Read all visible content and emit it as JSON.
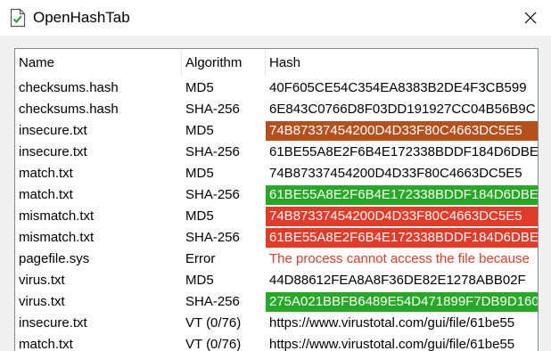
{
  "window": {
    "title": "OpenHashTab",
    "close_icon": "close-icon",
    "app_icon": "document-check-icon"
  },
  "columns": {
    "name": "Name",
    "algorithm": "Algorithm",
    "hash": "Hash"
  },
  "colors": {
    "insecure": "#b5501c",
    "match": "#27a827",
    "mismatch": "#e23b2a",
    "error_text": "#e23b2a",
    "selected_text": "#ffffff"
  },
  "rows": [
    {
      "name": "checksums.hash",
      "algorithm": "MD5",
      "hash": "40F605CE54C354EA8383B2DE4F3CB599",
      "status": "none"
    },
    {
      "name": "checksums.hash",
      "algorithm": "SHA-256",
      "hash": "6E843C0766D8F03DD191927CC04B56B9C",
      "status": "none"
    },
    {
      "name": "insecure.txt",
      "algorithm": "MD5",
      "hash": "74B87337454200D4D33F80C4663DC5E5",
      "status": "insecure"
    },
    {
      "name": "insecure.txt",
      "algorithm": "SHA-256",
      "hash": "61BE55A8E2F6B4E172338BDDF184D6DBE",
      "status": "none"
    },
    {
      "name": "match.txt",
      "algorithm": "MD5",
      "hash": "74B87337454200D4D33F80C4663DC5E5",
      "status": "none"
    },
    {
      "name": "match.txt",
      "algorithm": "SHA-256",
      "hash": "61BE55A8E2F6B4E172338BDDF184D6DBE",
      "status": "match"
    },
    {
      "name": "mismatch.txt",
      "algorithm": "MD5",
      "hash": "74B87337454200D4D33F80C4663DC5E5",
      "status": "mismatch"
    },
    {
      "name": "mismatch.txt",
      "algorithm": "SHA-256",
      "hash": "61BE55A8E2F6B4E172338BDDF184D6DBE",
      "status": "mismatch"
    },
    {
      "name": "pagefile.sys",
      "algorithm": "Error",
      "hash": "The process cannot access the file because",
      "status": "error"
    },
    {
      "name": "virus.txt",
      "algorithm": "MD5",
      "hash": "44D88612FEA8A8F36DE82E1278ABB02F",
      "status": "none"
    },
    {
      "name": "virus.txt",
      "algorithm": "SHA-256",
      "hash": "275A021BBFB6489E54D471899F7DB9D160",
      "status": "match"
    },
    {
      "name": "insecure.txt",
      "algorithm": "VT (0/76)",
      "hash": "https://www.virustotal.com/gui/file/61be55",
      "status": "none"
    },
    {
      "name": "match.txt",
      "algorithm": "VT (0/76)",
      "hash": "https://www.virustotal.com/gui/file/61be55",
      "status": "none"
    }
  ]
}
